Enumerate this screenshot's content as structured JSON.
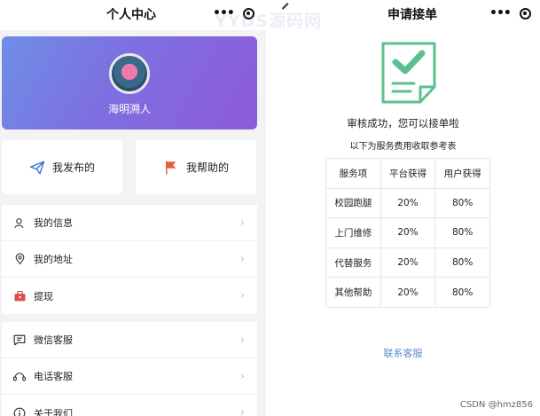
{
  "left": {
    "nav_title": "个人中心",
    "profile": {
      "nickname": "海明溯人"
    },
    "actions": [
      {
        "label": "我发布的",
        "icon": "paper-plane-icon"
      },
      {
        "label": "我帮助的",
        "icon": "flag-icon"
      }
    ],
    "menu_group_1": [
      {
        "label": "我的信息",
        "icon": "user-icon"
      },
      {
        "label": "我的地址",
        "icon": "location-icon"
      },
      {
        "label": "提现",
        "icon": "wallet-icon"
      }
    ],
    "menu_group_2": [
      {
        "label": "微信客服",
        "icon": "chat-icon"
      },
      {
        "label": "电话客服",
        "icon": "headset-icon"
      },
      {
        "label": "关于我们",
        "icon": "info-icon"
      }
    ]
  },
  "right": {
    "nav_title": "申请接单",
    "success_text": "审核成功，您可以接单啦",
    "sub_text": "以下为服务费用收取参考表",
    "table": {
      "headers": [
        "服务项",
        "平台获得",
        "用户获得"
      ],
      "rows": [
        [
          "校园跑腿",
          "20%",
          "80%"
        ],
        [
          "上门维修",
          "20%",
          "80%"
        ],
        [
          "代替服务",
          "20%",
          "80%"
        ],
        [
          "其他帮助",
          "20%",
          "80%"
        ]
      ]
    },
    "contact_label": "联系客服"
  },
  "overlay": {
    "watermark": "YYDS源码网",
    "credit": "CSDN @hmz856"
  },
  "colors": {
    "accent_green": "#5cc08e",
    "link_blue": "#5b8ad0",
    "gradient_start": "#6e8ee6",
    "gradient_end": "#8e5bd8",
    "flag_orange": "#e0623a",
    "wallet_red": "#e04a4a"
  }
}
